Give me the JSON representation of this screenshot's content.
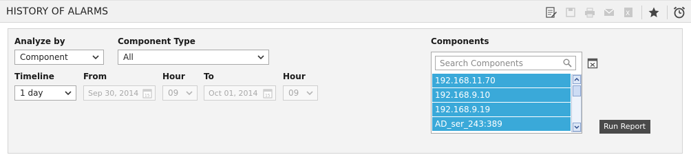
{
  "header": {
    "title": "HISTORY OF ALARMS",
    "toolbar_icons": [
      "edit-report-icon",
      "save-icon",
      "print-icon",
      "email-icon",
      "export-excel-icon",
      "favorite-star-icon",
      "schedule-alarm-clock-icon"
    ]
  },
  "form": {
    "analyze_by": {
      "label": "Analyze by",
      "value": "Component"
    },
    "component_type": {
      "label": "Component Type",
      "value": "All"
    },
    "timeline": {
      "label": "Timeline",
      "value": "1 day"
    },
    "from": {
      "label": "From",
      "date": "Sep 30, 2014",
      "cal_day": "15"
    },
    "from_hour": {
      "label": "Hour",
      "value": "09"
    },
    "to": {
      "label": "To",
      "date": "Oct 01, 2014",
      "cal_day": "15"
    },
    "to_hour": {
      "label": "Hour",
      "value": "09"
    }
  },
  "components": {
    "label": "Components",
    "search_placeholder": "Search Components",
    "items": [
      "192.168.11.70",
      "192.168.9.10",
      "192.168.9.19",
      "AD_ser_243:389"
    ]
  },
  "run_button": {
    "label": "Run Report"
  },
  "colors": {
    "selected_item": "#3aa9d9",
    "run_button": "#4a4a4a",
    "panel_bg": "#f3f3f3"
  }
}
